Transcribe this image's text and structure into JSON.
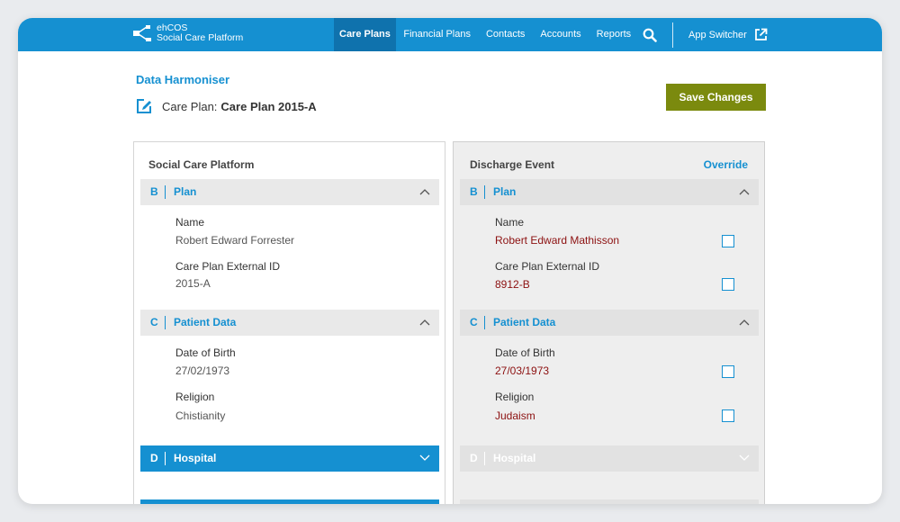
{
  "brand": {
    "line1": "ehCOS",
    "line2": "Social Care Platform"
  },
  "nav": {
    "items": [
      {
        "label": "Care Plans",
        "active": true
      },
      {
        "label": "Financial Plans",
        "active": false
      },
      {
        "label": "Contacts",
        "active": false
      },
      {
        "label": "Accounts",
        "active": false
      },
      {
        "label": "Reports",
        "active": false
      }
    ],
    "search_icon": "search-icon",
    "app_switcher": "App Switcher",
    "app_switcher_icon": "external-link-icon"
  },
  "header": {
    "title": "Data Harmoniser",
    "plan_prefix": "Care Plan:",
    "plan_value": "Care Plan 2015-A",
    "edit_icon": "edit-icon",
    "save_label": "Save Changes"
  },
  "left": {
    "heading": "Social Care Platform",
    "sections": {
      "plan": {
        "letter": "B",
        "title": "Plan",
        "fields": [
          {
            "label": "Name",
            "value": "Robert Edward Forrester"
          },
          {
            "label": "Care Plan External ID",
            "value": "2015-A"
          }
        ]
      },
      "patient": {
        "letter": "C",
        "title": "Patient Data",
        "fields": [
          {
            "label": "Date of Birth",
            "value": "27/02/1973"
          },
          {
            "label": "Religion",
            "value": "Chistianity"
          }
        ]
      },
      "hospital": {
        "letter": "D",
        "title": "Hospital"
      }
    }
  },
  "right": {
    "heading": "Discharge Event",
    "override": "Override",
    "sections": {
      "plan": {
        "letter": "B",
        "title": "Plan",
        "fields": [
          {
            "label": "Name",
            "value": "Robert Edward Mathisson"
          },
          {
            "label": "Care Plan External ID",
            "value": "8912-B"
          }
        ]
      },
      "patient": {
        "letter": "C",
        "title": "Patient Data",
        "fields": [
          {
            "label": "Date of Birth",
            "value": "27/03/1973"
          },
          {
            "label": "Religion",
            "value": "Judaism"
          }
        ]
      },
      "hospital": {
        "letter": "D",
        "title": "Hospital"
      }
    }
  },
  "colors": {
    "primary": "#1590d1",
    "nav_active": "#0f72ad",
    "save_button": "#7b8a0e",
    "conflict_text": "#8c1010"
  }
}
